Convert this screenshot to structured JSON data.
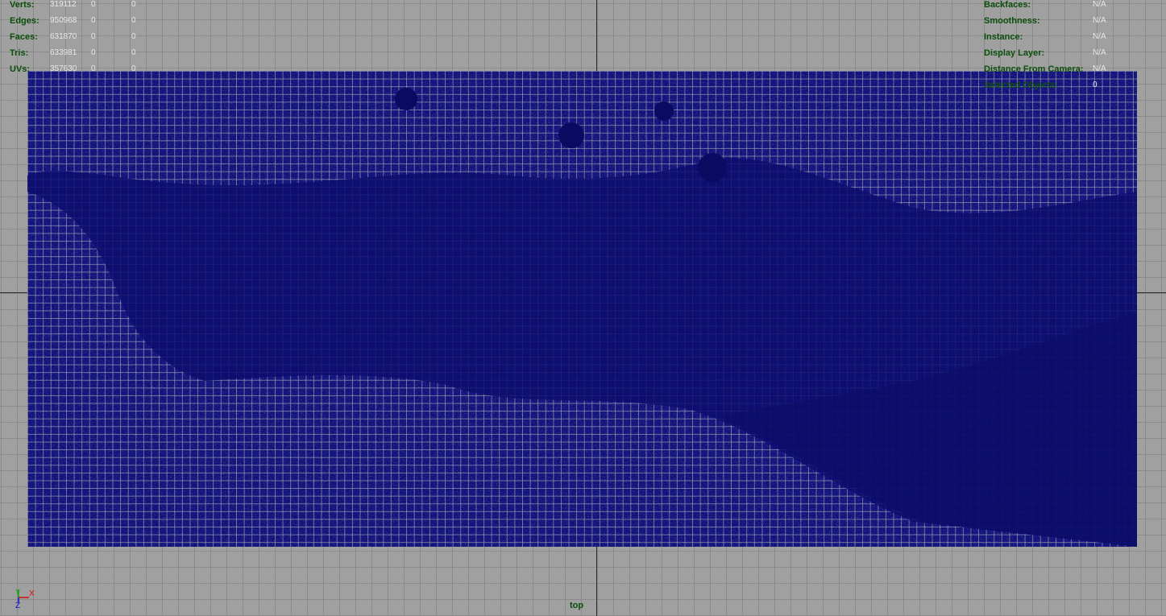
{
  "viewport": {
    "camera_name": "top",
    "colors": {
      "background": "#a0a0a0",
      "grid": "#8a8a8a",
      "mesh_fill": "#10107a",
      "mesh_wire": "#bebebe",
      "hud_label": "#0b4f0b",
      "hud_value": "#e8e8e8"
    }
  },
  "poly_count": {
    "rows": [
      {
        "label": "Verts:",
        "v1": "319112",
        "v2": "0",
        "v3": "0"
      },
      {
        "label": "Edges:",
        "v1": "950968",
        "v2": "0",
        "v3": "0"
      },
      {
        "label": "Faces:",
        "v1": "631870",
        "v2": "0",
        "v3": "0"
      },
      {
        "label": "Tris:",
        "v1": "633981",
        "v2": "0",
        "v3": "0"
      },
      {
        "label": "UVs:",
        "v1": "357630",
        "v2": "0",
        "v3": "0"
      }
    ]
  },
  "object_details": {
    "rows": [
      {
        "label": "Backfaces:",
        "value": "N/A"
      },
      {
        "label": "Smoothness:",
        "value": "N/A"
      },
      {
        "label": "Instance:",
        "value": "N/A"
      },
      {
        "label": "Display Layer:",
        "value": "N/A"
      },
      {
        "label": "Distance From Camera:",
        "value": "N/A"
      },
      {
        "label": "Selected Objects:",
        "value": "0"
      }
    ]
  },
  "axis_gizmo": {
    "x_label": "X",
    "y_label": "Y",
    "z_label": "Z"
  }
}
